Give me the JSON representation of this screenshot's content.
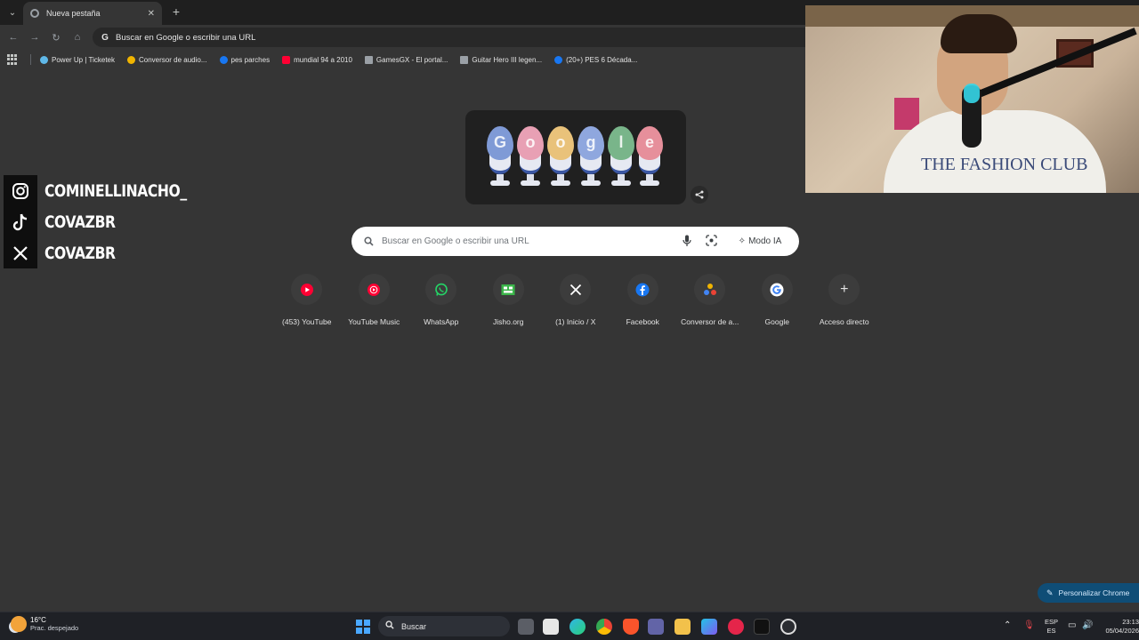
{
  "browser": {
    "tab": {
      "title": "Nueva pestaña"
    },
    "omnibox": {
      "text": "Buscar en Google o escribir una URL"
    },
    "bookmarks": [
      {
        "label": "Power Up | Ticketek",
        "icon": "ticketek-icon",
        "color": "#5fb8e8"
      },
      {
        "label": "Conversor de audio...",
        "icon": "converter-icon",
        "color": "#f0b400"
      },
      {
        "label": "pes parches",
        "icon": "facebook-icon",
        "color": "#1877f2"
      },
      {
        "label": "mundial 94 a 2010",
        "icon": "youtube-icon",
        "color": "#ff0033"
      },
      {
        "label": "GamesGX - El portal...",
        "icon": "gamesgx-icon",
        "color": "#9aa0a6"
      },
      {
        "label": "Guitar Hero III legen...",
        "icon": "guitarhero-icon",
        "color": "#9aa0a6"
      },
      {
        "label": "(20+) PES 6 Década...",
        "icon": "facebook-icon",
        "color": "#1877f2"
      }
    ]
  },
  "social": [
    {
      "icon": "instagram-icon",
      "handle": "COMINELLINACHO_"
    },
    {
      "icon": "tiktok-icon",
      "handle": "COVAZBR"
    },
    {
      "icon": "x-icon",
      "handle": "COVAZBR"
    }
  ],
  "webcam": {
    "shirt_text": "THE FASHION CLUB"
  },
  "doodle": {
    "letters": [
      "G",
      "o",
      "o",
      "g",
      "l",
      "e"
    ],
    "egg_colors": [
      "#7f9ad6",
      "#e8a0b4",
      "#e9c27a",
      "#8fa7de",
      "#79b58a",
      "#e68f9b"
    ]
  },
  "search": {
    "placeholder": "Buscar en Google o escribir una URL",
    "ai_mode_label": "Modo IA"
  },
  "shortcuts": [
    {
      "label": "(453) YouTube",
      "icon": "youtube-icon",
      "color": "#ff0033"
    },
    {
      "label": "YouTube Music",
      "icon": "youtube-music-icon",
      "color": "#ff0033"
    },
    {
      "label": "WhatsApp",
      "icon": "whatsapp-icon",
      "color": "#25d366"
    },
    {
      "label": "Jisho.org",
      "icon": "jisho-icon",
      "color": "#3bb54a"
    },
    {
      "label": "(1) Inicio / X",
      "icon": "x-icon",
      "color": "#ffffff"
    },
    {
      "label": "Facebook",
      "icon": "facebook-icon",
      "color": "#1877f2"
    },
    {
      "label": "Conversor de a...",
      "icon": "converter-icon",
      "color": "#f0b400"
    },
    {
      "label": "Google",
      "icon": "google-icon",
      "color": "#4285f4"
    },
    {
      "label": "Acceso directo",
      "icon": "plus-icon",
      "color": "#e3e3e3"
    }
  ],
  "customize": {
    "label": "Personalizar Chrome"
  },
  "taskbar": {
    "weather": {
      "temp": "16°C",
      "condition": "Prac. despejado"
    },
    "search_label": "Buscar",
    "lang_top": "ESP",
    "lang_bottom": "ES",
    "time": "23:13",
    "date": "05/04/2026"
  }
}
